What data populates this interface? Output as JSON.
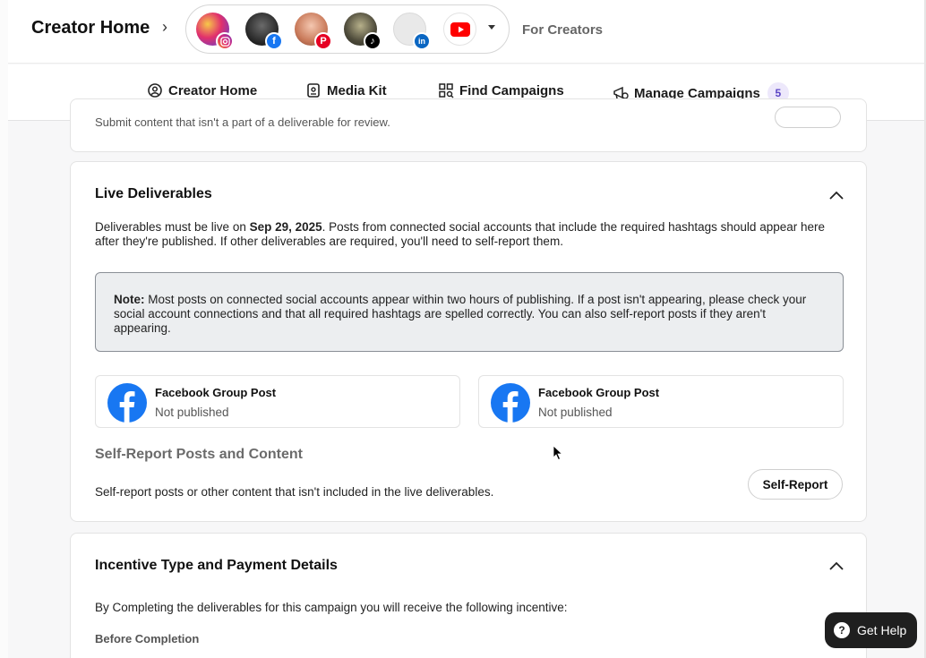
{
  "header": {
    "title": "Creator Home",
    "for_creators": "For Creators",
    "accounts": [
      {
        "platform": "instagram",
        "badge": "instagram-icon",
        "badge_color": "#d6249f"
      },
      {
        "platform": "facebook",
        "badge": "f",
        "badge_color": "#1877f2"
      },
      {
        "platform": "pinterest",
        "badge": "P",
        "badge_color": "#e60023"
      },
      {
        "platform": "tiktok",
        "badge": "♪",
        "badge_color": "#000000"
      },
      {
        "platform": "linkedin",
        "badge": "in",
        "badge_color": "#0a66c2"
      },
      {
        "platform": "youtube",
        "badge": "youtube-icon",
        "badge_color": "#ff0000"
      }
    ]
  },
  "nav": {
    "items": [
      {
        "label": "Creator Home",
        "icon": "creator-home-icon"
      },
      {
        "label": "Media Kit",
        "icon": "media-kit-icon"
      },
      {
        "label": "Find Campaigns",
        "icon": "find-campaigns-icon"
      },
      {
        "label": "Manage Campaigns",
        "icon": "manage-campaigns-icon",
        "count": "5"
      }
    ]
  },
  "top_card": {
    "cut_text": "Submit content that isn't a part of a deliverable for review."
  },
  "live_deliverables": {
    "title": "Live Deliverables",
    "desc_prefix": "Deliverables must be live on ",
    "date": "Sep 29, 2025",
    "desc_suffix": ". Posts from connected social accounts that include the required hashtags should appear here after they're published. If other deliverables are required, you'll need to self-report them.",
    "note_label": "Note:",
    "note_text": " Most posts on connected social accounts appear within two hours of publishing. If a post isn't appearing, please check your social account connections and that all required hashtags are spelled correctly. You can also self-report posts if they aren't appearing.",
    "posts": [
      {
        "title": "Facebook Group Post",
        "status": "Not published"
      },
      {
        "title": "Facebook Group Post",
        "status": "Not published"
      }
    ],
    "self_report_heading": "Self-Report Posts and Content",
    "self_report_desc": "Self-report posts or other content that isn't included in the live deliverables.",
    "self_report_button": "Self-Report"
  },
  "incentive": {
    "title": "Incentive Type and Payment Details",
    "desc": "By Completing the deliverables for this campaign you will receive the following incentive:",
    "before_completion": "Before Completion"
  },
  "help": {
    "label": "Get Help",
    "icon_glyph": "?"
  },
  "colors": {
    "facebook": "#1877f2",
    "accent_purple": "#5b45c4"
  }
}
